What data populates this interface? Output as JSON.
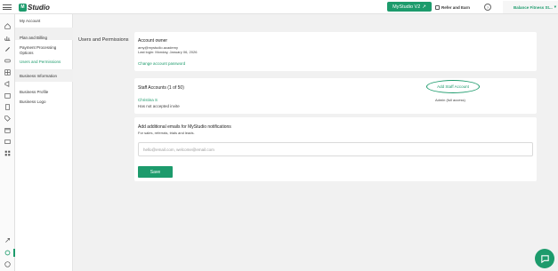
{
  "topbar": {
    "logo_text": "Studio",
    "logo_mark": "M",
    "version_label": "MyStudio V2",
    "refer_label": "Refer and Earn",
    "help_label": "?",
    "business_name": "Balance Fitness St..."
  },
  "subnav": {
    "my_account": "My Account",
    "plan_billing": "Plan and Billing",
    "payment_processing_1": "Payment Processing",
    "payment_processing_2": "Options",
    "users_permissions": "Users and Permissions",
    "business_information": "Business Information",
    "business_profile": "Business Profile",
    "business_logo": "Business Logo"
  },
  "main": {
    "section_title": "Users and Permissions",
    "owner": {
      "heading": "Account owner",
      "email": "amy@mystudio.academy",
      "last_login": "Last login: Monday, January 06, 2026",
      "change_password": "Change account password"
    },
    "staff": {
      "heading": "Staff Accounts (1 of 50)",
      "add_button": "Add Staff Account",
      "member_name": "Christina S",
      "member_status": "Has not accepted invite",
      "member_role": "Admin (full access)"
    },
    "emails": {
      "heading": "Add additional emails for MyStudio notifications",
      "subheading": "For sales, referrals, trials and leads.",
      "placeholder": "hello@email.com, welcome@email.com",
      "save_label": "Save"
    }
  },
  "colors": {
    "accent": "#1d9b6c"
  },
  "icons": [
    "home-icon",
    "chart-icon",
    "pencil-icon",
    "car-icon",
    "grid-icon",
    "megaphone-icon",
    "calendar-icon",
    "clipboard-icon",
    "tag-icon",
    "box-icon",
    "id-card-icon",
    "apps-icon",
    "rocket-icon",
    "settings-icon",
    "help-icon",
    "chat-icon"
  ]
}
